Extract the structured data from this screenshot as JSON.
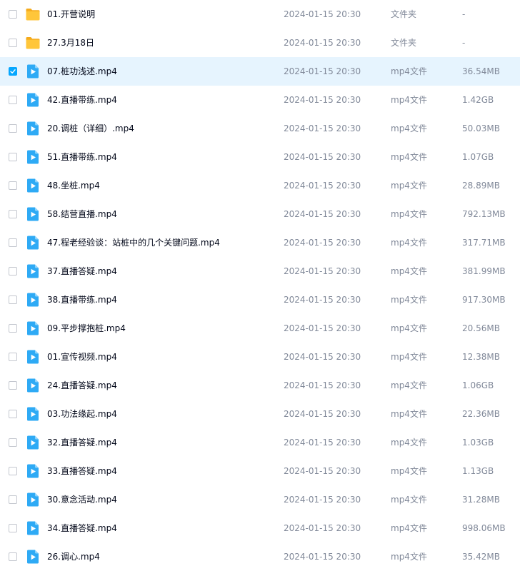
{
  "colors": {
    "accent": "#06a7ff",
    "selected_row_bg": "#e6f4fe",
    "folder": "#ffc63a",
    "video_icon": "#2eaaf5"
  },
  "files": [
    {
      "name": "01.开营说明",
      "time": "2024-01-15 20:30",
      "type": "文件夹",
      "size": "-",
      "icon": "folder-icon",
      "selected": false
    },
    {
      "name": "27.3月18日",
      "time": "2024-01-15 20:30",
      "type": "文件夹",
      "size": "-",
      "icon": "folder-icon",
      "selected": false
    },
    {
      "name": "07.桩功浅述.mp4",
      "time": "2024-01-15 20:30",
      "type": "mp4文件",
      "size": "36.54MB",
      "icon": "video-file-icon",
      "selected": true
    },
    {
      "name": "42.直播带练.mp4",
      "time": "2024-01-15 20:30",
      "type": "mp4文件",
      "size": "1.42GB",
      "icon": "video-file-icon",
      "selected": false
    },
    {
      "name": "20.调桩（详细）.mp4",
      "time": "2024-01-15 20:30",
      "type": "mp4文件",
      "size": "50.03MB",
      "icon": "video-file-icon",
      "selected": false
    },
    {
      "name": "51.直播带练.mp4",
      "time": "2024-01-15 20:30",
      "type": "mp4文件",
      "size": "1.07GB",
      "icon": "video-file-icon",
      "selected": false
    },
    {
      "name": "48.坐桩.mp4",
      "time": "2024-01-15 20:30",
      "type": "mp4文件",
      "size": "28.89MB",
      "icon": "video-file-icon",
      "selected": false
    },
    {
      "name": "58.结营直播.mp4",
      "time": "2024-01-15 20:30",
      "type": "mp4文件",
      "size": "792.13MB",
      "icon": "video-file-icon",
      "selected": false
    },
    {
      "name": "47.程老经验谈：站桩中的几个关键问题.mp4",
      "time": "2024-01-15 20:30",
      "type": "mp4文件",
      "size": "317.71MB",
      "icon": "video-file-icon",
      "selected": false
    },
    {
      "name": "37.直播答疑.mp4",
      "time": "2024-01-15 20:30",
      "type": "mp4文件",
      "size": "381.99MB",
      "icon": "video-file-icon",
      "selected": false
    },
    {
      "name": "38.直播带练.mp4",
      "time": "2024-01-15 20:30",
      "type": "mp4文件",
      "size": "917.30MB",
      "icon": "video-file-icon",
      "selected": false
    },
    {
      "name": "09.平步撑抱桩.mp4",
      "time": "2024-01-15 20:30",
      "type": "mp4文件",
      "size": "20.56MB",
      "icon": "video-file-icon",
      "selected": false
    },
    {
      "name": "01.宣传视频.mp4",
      "time": "2024-01-15 20:30",
      "type": "mp4文件",
      "size": "12.38MB",
      "icon": "video-file-icon",
      "selected": false
    },
    {
      "name": "24.直播答疑.mp4",
      "time": "2024-01-15 20:30",
      "type": "mp4文件",
      "size": "1.06GB",
      "icon": "video-file-icon",
      "selected": false
    },
    {
      "name": "03.功法缘起.mp4",
      "time": "2024-01-15 20:30",
      "type": "mp4文件",
      "size": "22.36MB",
      "icon": "video-file-icon",
      "selected": false
    },
    {
      "name": "32.直播答疑.mp4",
      "time": "2024-01-15 20:30",
      "type": "mp4文件",
      "size": "1.03GB",
      "icon": "video-file-icon",
      "selected": false
    },
    {
      "name": "33.直播答疑.mp4",
      "time": "2024-01-15 20:30",
      "type": "mp4文件",
      "size": "1.13GB",
      "icon": "video-file-icon",
      "selected": false
    },
    {
      "name": "30.意念活动.mp4",
      "time": "2024-01-15 20:30",
      "type": "mp4文件",
      "size": "31.28MB",
      "icon": "video-file-icon",
      "selected": false
    },
    {
      "name": "34.直播答疑.mp4",
      "time": "2024-01-15 20:30",
      "type": "mp4文件",
      "size": "998.06MB",
      "icon": "video-file-icon",
      "selected": false
    },
    {
      "name": "26.调心.mp4",
      "time": "2024-01-15 20:30",
      "type": "mp4文件",
      "size": "35.42MB",
      "icon": "video-file-icon",
      "selected": false
    }
  ]
}
